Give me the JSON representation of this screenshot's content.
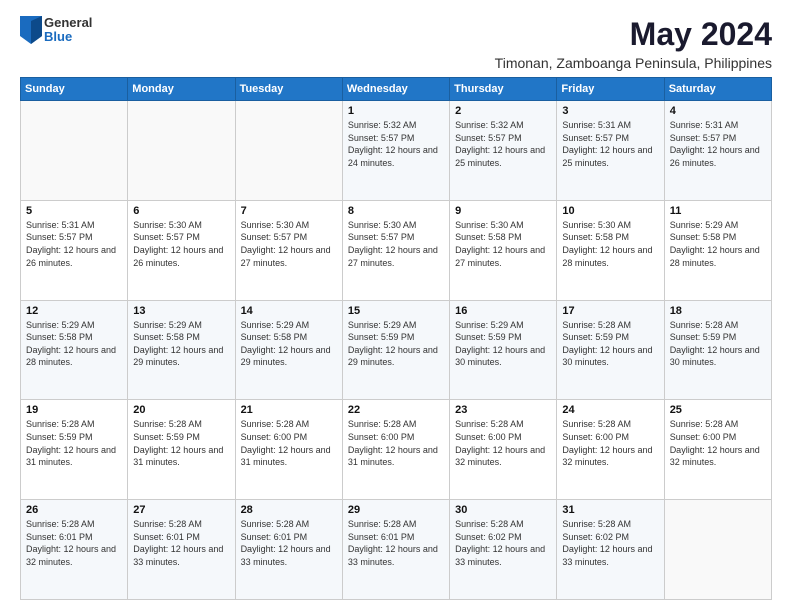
{
  "logo": {
    "general": "General",
    "blue": "Blue"
  },
  "title": "May 2024",
  "location": "Timonan, Zamboanga Peninsula, Philippines",
  "days_of_week": [
    "Sunday",
    "Monday",
    "Tuesday",
    "Wednesday",
    "Thursday",
    "Friday",
    "Saturday"
  ],
  "weeks": [
    [
      {
        "day": "",
        "sunrise": "",
        "sunset": "",
        "daylight": ""
      },
      {
        "day": "",
        "sunrise": "",
        "sunset": "",
        "daylight": ""
      },
      {
        "day": "",
        "sunrise": "",
        "sunset": "",
        "daylight": ""
      },
      {
        "day": "1",
        "sunrise": "Sunrise: 5:32 AM",
        "sunset": "Sunset: 5:57 PM",
        "daylight": "Daylight: 12 hours and 24 minutes."
      },
      {
        "day": "2",
        "sunrise": "Sunrise: 5:32 AM",
        "sunset": "Sunset: 5:57 PM",
        "daylight": "Daylight: 12 hours and 25 minutes."
      },
      {
        "day": "3",
        "sunrise": "Sunrise: 5:31 AM",
        "sunset": "Sunset: 5:57 PM",
        "daylight": "Daylight: 12 hours and 25 minutes."
      },
      {
        "day": "4",
        "sunrise": "Sunrise: 5:31 AM",
        "sunset": "Sunset: 5:57 PM",
        "daylight": "Daylight: 12 hours and 26 minutes."
      }
    ],
    [
      {
        "day": "5",
        "sunrise": "Sunrise: 5:31 AM",
        "sunset": "Sunset: 5:57 PM",
        "daylight": "Daylight: 12 hours and 26 minutes."
      },
      {
        "day": "6",
        "sunrise": "Sunrise: 5:30 AM",
        "sunset": "Sunset: 5:57 PM",
        "daylight": "Daylight: 12 hours and 26 minutes."
      },
      {
        "day": "7",
        "sunrise": "Sunrise: 5:30 AM",
        "sunset": "Sunset: 5:57 PM",
        "daylight": "Daylight: 12 hours and 27 minutes."
      },
      {
        "day": "8",
        "sunrise": "Sunrise: 5:30 AM",
        "sunset": "Sunset: 5:57 PM",
        "daylight": "Daylight: 12 hours and 27 minutes."
      },
      {
        "day": "9",
        "sunrise": "Sunrise: 5:30 AM",
        "sunset": "Sunset: 5:58 PM",
        "daylight": "Daylight: 12 hours and 27 minutes."
      },
      {
        "day": "10",
        "sunrise": "Sunrise: 5:30 AM",
        "sunset": "Sunset: 5:58 PM",
        "daylight": "Daylight: 12 hours and 28 minutes."
      },
      {
        "day": "11",
        "sunrise": "Sunrise: 5:29 AM",
        "sunset": "Sunset: 5:58 PM",
        "daylight": "Daylight: 12 hours and 28 minutes."
      }
    ],
    [
      {
        "day": "12",
        "sunrise": "Sunrise: 5:29 AM",
        "sunset": "Sunset: 5:58 PM",
        "daylight": "Daylight: 12 hours and 28 minutes."
      },
      {
        "day": "13",
        "sunrise": "Sunrise: 5:29 AM",
        "sunset": "Sunset: 5:58 PM",
        "daylight": "Daylight: 12 hours and 29 minutes."
      },
      {
        "day": "14",
        "sunrise": "Sunrise: 5:29 AM",
        "sunset": "Sunset: 5:58 PM",
        "daylight": "Daylight: 12 hours and 29 minutes."
      },
      {
        "day": "15",
        "sunrise": "Sunrise: 5:29 AM",
        "sunset": "Sunset: 5:59 PM",
        "daylight": "Daylight: 12 hours and 29 minutes."
      },
      {
        "day": "16",
        "sunrise": "Sunrise: 5:29 AM",
        "sunset": "Sunset: 5:59 PM",
        "daylight": "Daylight: 12 hours and 30 minutes."
      },
      {
        "day": "17",
        "sunrise": "Sunrise: 5:28 AM",
        "sunset": "Sunset: 5:59 PM",
        "daylight": "Daylight: 12 hours and 30 minutes."
      },
      {
        "day": "18",
        "sunrise": "Sunrise: 5:28 AM",
        "sunset": "Sunset: 5:59 PM",
        "daylight": "Daylight: 12 hours and 30 minutes."
      }
    ],
    [
      {
        "day": "19",
        "sunrise": "Sunrise: 5:28 AM",
        "sunset": "Sunset: 5:59 PM",
        "daylight": "Daylight: 12 hours and 31 minutes."
      },
      {
        "day": "20",
        "sunrise": "Sunrise: 5:28 AM",
        "sunset": "Sunset: 5:59 PM",
        "daylight": "Daylight: 12 hours and 31 minutes."
      },
      {
        "day": "21",
        "sunrise": "Sunrise: 5:28 AM",
        "sunset": "Sunset: 6:00 PM",
        "daylight": "Daylight: 12 hours and 31 minutes."
      },
      {
        "day": "22",
        "sunrise": "Sunrise: 5:28 AM",
        "sunset": "Sunset: 6:00 PM",
        "daylight": "Daylight: 12 hours and 31 minutes."
      },
      {
        "day": "23",
        "sunrise": "Sunrise: 5:28 AM",
        "sunset": "Sunset: 6:00 PM",
        "daylight": "Daylight: 12 hours and 32 minutes."
      },
      {
        "day": "24",
        "sunrise": "Sunrise: 5:28 AM",
        "sunset": "Sunset: 6:00 PM",
        "daylight": "Daylight: 12 hours and 32 minutes."
      },
      {
        "day": "25",
        "sunrise": "Sunrise: 5:28 AM",
        "sunset": "Sunset: 6:00 PM",
        "daylight": "Daylight: 12 hours and 32 minutes."
      }
    ],
    [
      {
        "day": "26",
        "sunrise": "Sunrise: 5:28 AM",
        "sunset": "Sunset: 6:01 PM",
        "daylight": "Daylight: 12 hours and 32 minutes."
      },
      {
        "day": "27",
        "sunrise": "Sunrise: 5:28 AM",
        "sunset": "Sunset: 6:01 PM",
        "daylight": "Daylight: 12 hours and 33 minutes."
      },
      {
        "day": "28",
        "sunrise": "Sunrise: 5:28 AM",
        "sunset": "Sunset: 6:01 PM",
        "daylight": "Daylight: 12 hours and 33 minutes."
      },
      {
        "day": "29",
        "sunrise": "Sunrise: 5:28 AM",
        "sunset": "Sunset: 6:01 PM",
        "daylight": "Daylight: 12 hours and 33 minutes."
      },
      {
        "day": "30",
        "sunrise": "Sunrise: 5:28 AM",
        "sunset": "Sunset: 6:02 PM",
        "daylight": "Daylight: 12 hours and 33 minutes."
      },
      {
        "day": "31",
        "sunrise": "Sunrise: 5:28 AM",
        "sunset": "Sunset: 6:02 PM",
        "daylight": "Daylight: 12 hours and 33 minutes."
      },
      {
        "day": "",
        "sunrise": "",
        "sunset": "",
        "daylight": ""
      }
    ]
  ]
}
